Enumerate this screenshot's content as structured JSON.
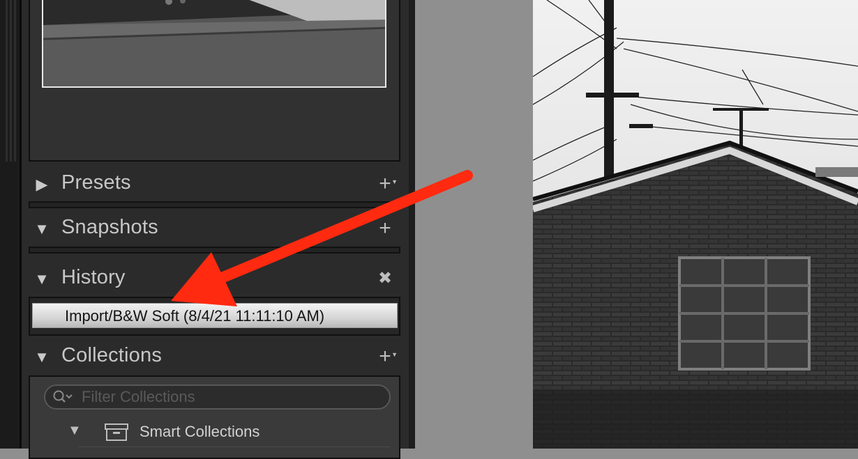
{
  "panels": {
    "presets": {
      "title": "Presets",
      "expanded": false,
      "action": "add-icon"
    },
    "snapshots": {
      "title": "Snapshots",
      "expanded": true,
      "action": "add-icon"
    },
    "history": {
      "title": "History",
      "expanded": true,
      "action": "clear-icon",
      "items": [
        {
          "label": "Import/B&W Soft (8/4/21 11:11:10 AM)"
        }
      ]
    },
    "collections": {
      "title": "Collections",
      "expanded": true,
      "action": "add-icon",
      "filter": {
        "placeholder": "Filter Collections",
        "value": ""
      },
      "items": [
        {
          "label": "Smart Collections",
          "icon": "collection-set-icon",
          "expanded": true
        }
      ]
    }
  },
  "colors": {
    "annotation_arrow": "#ff2a10",
    "panel_bg": "#2b2b2b",
    "history_highlight": "#e0e0e0"
  }
}
